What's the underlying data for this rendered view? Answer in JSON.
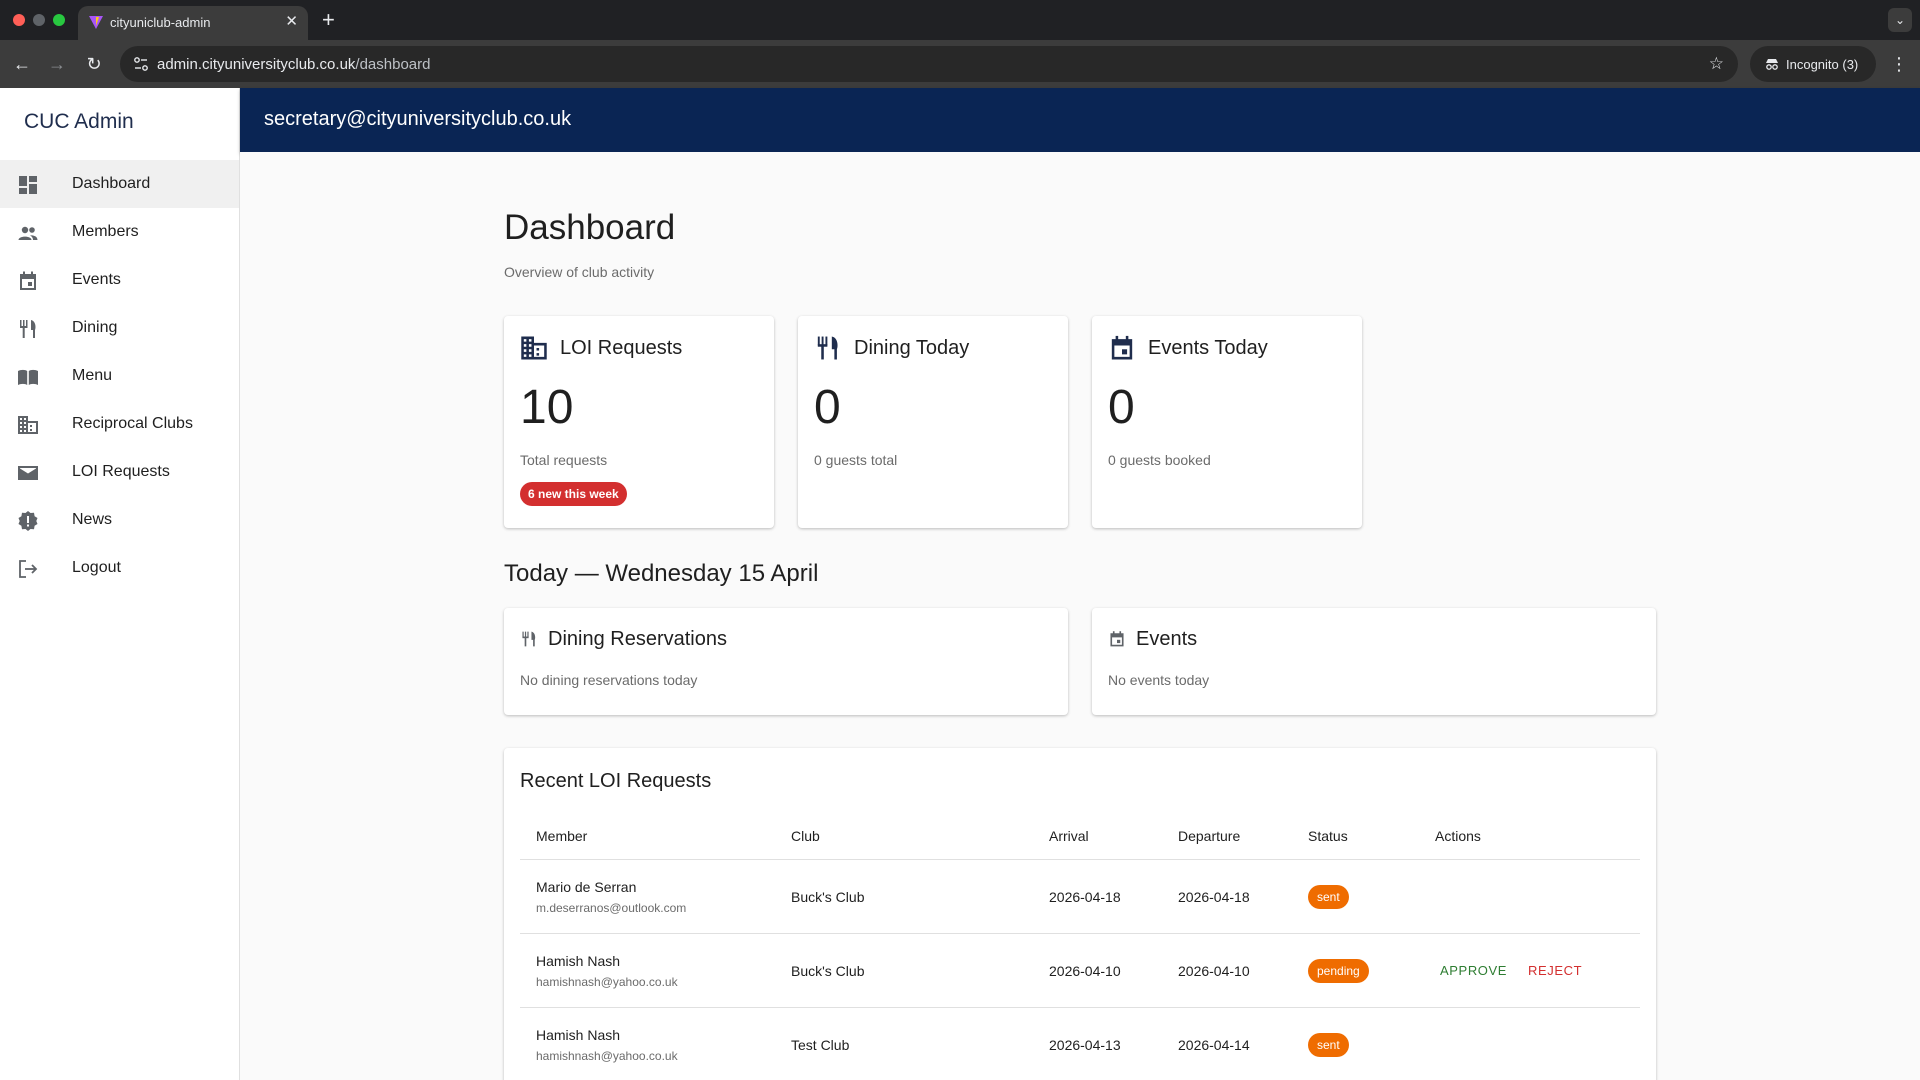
{
  "browser": {
    "tab_title": "cityuniclub-admin",
    "tab_close": "✕",
    "new_tab": "+",
    "url_host": "admin.cityuniversityclub.co.uk",
    "url_path": "/dashboard",
    "incognito_label": "Incognito (3)"
  },
  "sidebar": {
    "brand": "CUC Admin",
    "items": [
      {
        "label": "Dashboard",
        "icon": "dashboard-icon",
        "active": true
      },
      {
        "label": "Members",
        "icon": "people-icon"
      },
      {
        "label": "Events",
        "icon": "calendar-icon"
      },
      {
        "label": "Dining",
        "icon": "fork-knife-icon"
      },
      {
        "label": "Menu",
        "icon": "book-icon"
      },
      {
        "label": "Reciprocal Clubs",
        "icon": "building-icon"
      },
      {
        "label": "LOI Requests",
        "icon": "mail-icon"
      },
      {
        "label": "News",
        "icon": "alert-badge-icon"
      },
      {
        "label": "Logout",
        "icon": "logout-icon"
      }
    ]
  },
  "header": {
    "email": "secretary@cityuniversityclub.co.uk"
  },
  "page": {
    "title": "Dashboard",
    "subtitle": "Overview of club activity"
  },
  "stats": [
    {
      "title": "LOI Requests",
      "icon": "building-icon",
      "value": "10",
      "caption": "Total requests",
      "badge": "6 new this week"
    },
    {
      "title": "Dining Today",
      "icon": "fork-knife-icon",
      "value": "0",
      "caption": "0 guests total"
    },
    {
      "title": "Events Today",
      "icon": "calendar-icon",
      "value": "0",
      "caption": "0 guests booked"
    }
  ],
  "today": {
    "title": "Today — Wednesday 15 April",
    "dining": {
      "title": "Dining Reservations",
      "empty": "No dining reservations today"
    },
    "events": {
      "title": "Events",
      "empty": "No events today"
    }
  },
  "loi": {
    "title": "Recent LOI Requests",
    "columns": [
      "Member",
      "Club",
      "Arrival",
      "Departure",
      "Status",
      "Actions"
    ],
    "rows": [
      {
        "name": "Mario de Serran",
        "email": "m.deserranos@outlook.com",
        "club": "Buck's Club",
        "arrival": "2026-04-18",
        "departure": "2026-04-18",
        "status": "sent"
      },
      {
        "name": "Hamish Nash",
        "email": "hamishnash@yahoo.co.uk",
        "club": "Buck's Club",
        "arrival": "2026-04-10",
        "departure": "2026-04-10",
        "status": "pending",
        "approve": "APPROVE",
        "reject": "REJECT"
      },
      {
        "name": "Hamish Nash",
        "email": "hamishnash@yahoo.co.uk",
        "club": "Test Club",
        "arrival": "2026-04-13",
        "departure": "2026-04-14",
        "status": "sent"
      }
    ]
  },
  "colors": {
    "appbar": "#0a2554",
    "badge_red": "#d32f2f",
    "status_chip": "#ef6c00",
    "approve": "#2e7d32",
    "reject": "#d32f2f"
  }
}
